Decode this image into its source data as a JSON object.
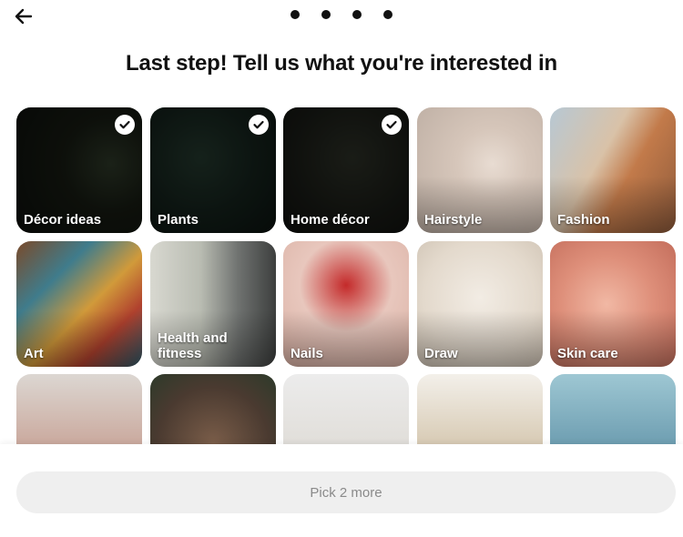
{
  "header": {
    "back_icon": "arrow-left-icon",
    "progress_steps": 4,
    "title": "Last step! Tell us what you're interested in"
  },
  "topics": [
    {
      "label": "Décor ideas",
      "selected": true
    },
    {
      "label": "Plants",
      "selected": true
    },
    {
      "label": "Home décor",
      "selected": true
    },
    {
      "label": "Hairstyle",
      "selected": false
    },
    {
      "label": "Fashion",
      "selected": false
    },
    {
      "label": "Art",
      "selected": false
    },
    {
      "label": "Health and fitness",
      "selected": false
    },
    {
      "label": "Nails",
      "selected": false
    },
    {
      "label": "Draw",
      "selected": false
    },
    {
      "label": "Skin care",
      "selected": false
    },
    {
      "label": "",
      "selected": false
    },
    {
      "label": "",
      "selected": false
    },
    {
      "label": "",
      "selected": false
    },
    {
      "label": "",
      "selected": false
    },
    {
      "label": "",
      "selected": false
    }
  ],
  "footer": {
    "button_label": "Pick 2 more"
  },
  "colors": {
    "primary_text": "#111111",
    "button_bg": "#efefef",
    "button_text": "#8a8a8a"
  }
}
